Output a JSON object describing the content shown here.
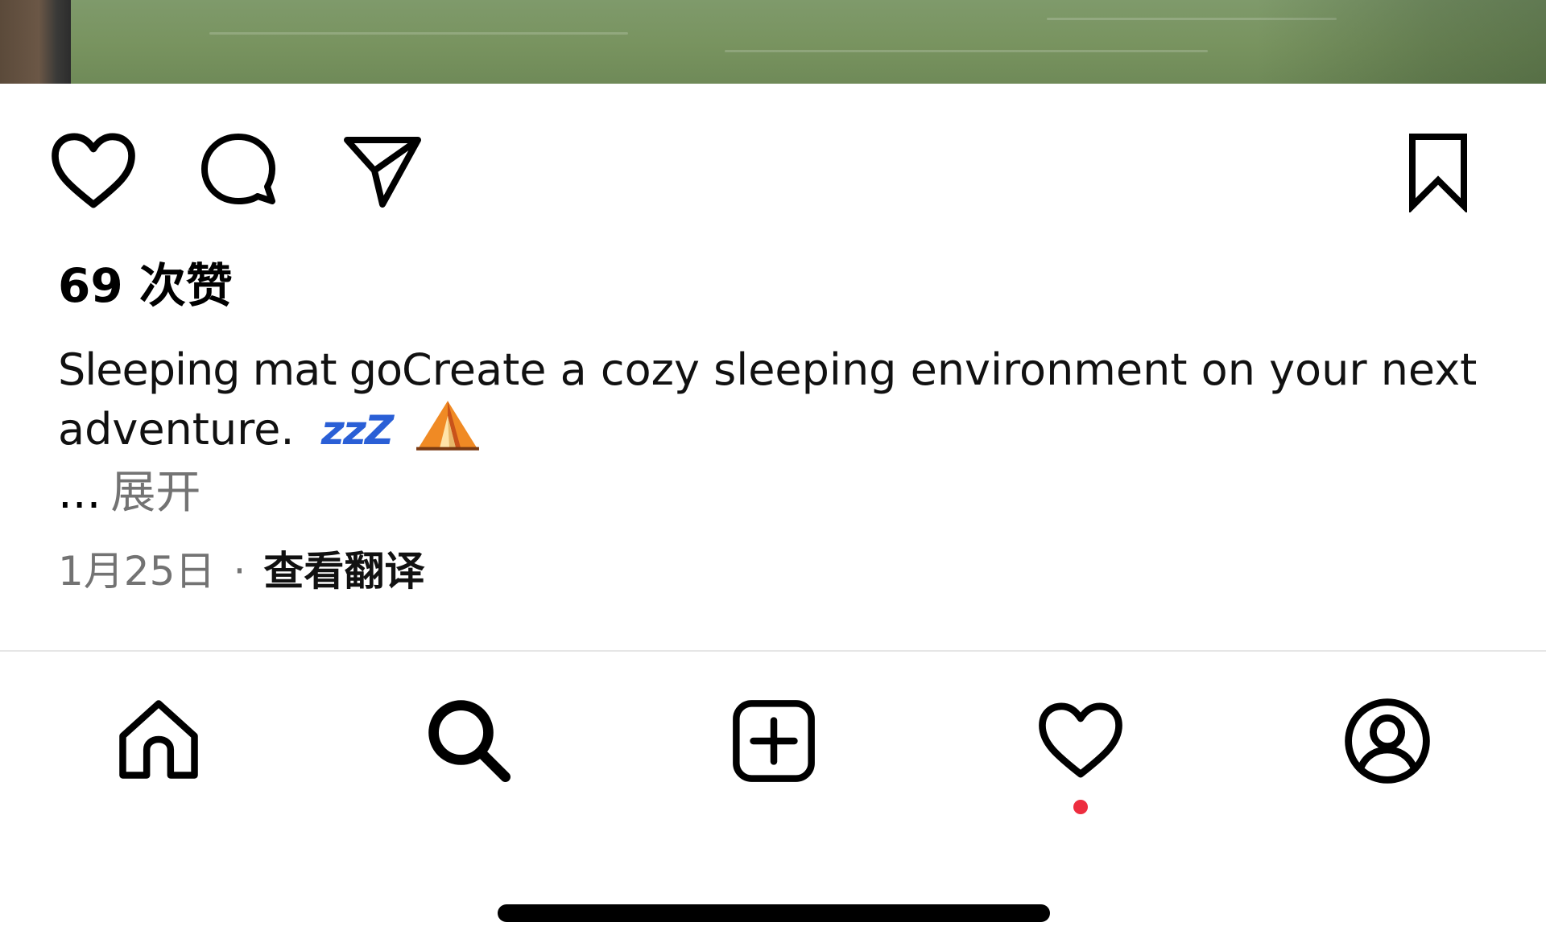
{
  "post": {
    "likes_label": "69 次赞",
    "caption_username": "Sleeping mat go",
    "caption_text": "Create a cozy sleeping environment on your next adventure.",
    "caption_zzz": "zzZ",
    "more_ellipsis": "...",
    "more_label": "展开",
    "date": "1月25日",
    "separator": "·",
    "translate_label": "查看翻译"
  },
  "icons": {
    "like": "heart-icon",
    "comment": "comment-bubble-icon",
    "share": "paper-plane-icon",
    "save": "bookmark-icon",
    "caption_emoji_1": "zzz-emoji-icon",
    "caption_emoji_2": "tent-emoji-icon"
  },
  "nav": {
    "items": [
      {
        "id": "home",
        "icon": "home-icon"
      },
      {
        "id": "search",
        "icon": "search-icon"
      },
      {
        "id": "create",
        "icon": "plus-square-icon"
      },
      {
        "id": "activity",
        "icon": "heart-icon",
        "has_notification": true
      },
      {
        "id": "profile",
        "icon": "user-circle-icon"
      }
    ]
  },
  "colors": {
    "text_primary": "#000000",
    "text_secondary": "#737373",
    "notification": "#ed2d3f",
    "photo_green": "#78935f"
  }
}
